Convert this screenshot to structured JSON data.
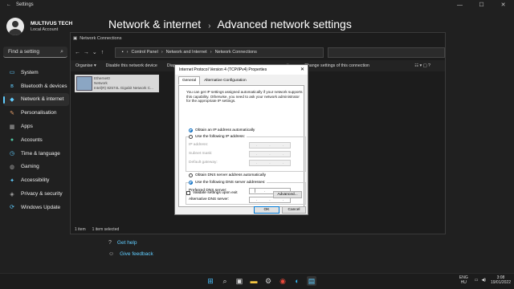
{
  "settings": {
    "title": "Settings",
    "window_controls": {
      "minimize": "—",
      "maximize": "☐",
      "close": "✕"
    },
    "profile": {
      "name": "MULTIVUS TECH",
      "subtitle": "Local Account"
    },
    "search": {
      "placeholder": "Find a setting",
      "icon": "search-icon"
    },
    "nav": [
      {
        "label": "System",
        "icon": "monitor-icon",
        "glyph": "▭",
        "color": "#60cdff"
      },
      {
        "label": "Bluetooth & devices",
        "icon": "bluetooth-icon",
        "glyph": "ʙ",
        "color": "#60cdff"
      },
      {
        "label": "Network & internet",
        "icon": "wifi-icon",
        "glyph": "◆",
        "color": "#60cdff",
        "active": true
      },
      {
        "label": "Personalisation",
        "icon": "brush-icon",
        "glyph": "✎",
        "color": "#e8a16c"
      },
      {
        "label": "Apps",
        "icon": "apps-icon",
        "glyph": "▦",
        "color": "#a6a6a6"
      },
      {
        "label": "Accounts",
        "icon": "person-icon",
        "glyph": "●",
        "color": "#4fc3a1"
      },
      {
        "label": "Time & language",
        "icon": "clock-icon",
        "glyph": "◷",
        "color": "#60cdff"
      },
      {
        "label": "Gaming",
        "icon": "gamepad-icon",
        "glyph": "◍",
        "color": "#a6a6a6"
      },
      {
        "label": "Accessibility",
        "icon": "accessibility-icon",
        "glyph": "✦",
        "color": "#60cdff"
      },
      {
        "label": "Privacy & security",
        "icon": "shield-icon",
        "glyph": "◈",
        "color": "#a6a6a6"
      },
      {
        "label": "Windows Update",
        "icon": "update-icon",
        "glyph": "⟳",
        "color": "#60cdff"
      }
    ],
    "breadcrumb": {
      "parent": "Network & internet",
      "separator": "›",
      "current": "Advanced network settings"
    },
    "help_links": [
      {
        "label": "Get help",
        "icon": "help-icon"
      },
      {
        "label": "Give feedback",
        "icon": "feedback-icon"
      }
    ]
  },
  "network_connections": {
    "title": "Network Connections",
    "address": [
      "Control Panel",
      "Network and Internet",
      "Network Connections"
    ],
    "toolbar": [
      "Organise ▾",
      "Disable this network device",
      "Diagno"
    ],
    "toolbar_right": [
      "nection",
      "Change settings of this connection"
    ],
    "adapter": {
      "name": "Ethernet0",
      "status": "Network",
      "device": "Intel(R) 82574L Gigabit Network C..."
    },
    "status_bar": {
      "count": "1 item",
      "selected": "1 item selected"
    }
  },
  "ipv4_dialog": {
    "title": "Internet Protocol Version 4 (TCP/IPv4) Properties",
    "tabs": [
      "General",
      "Alternative Configuration"
    ],
    "description": "You can get IP settings assigned automatically if your network supports this capability. Otherwise, you need to ask your network administrator for the appropriate IP settings.",
    "obtain_ip_auto": "Obtain an IP address automatically",
    "use_ip": "Use the following IP address:",
    "ip_fields": [
      "IP address:",
      "Subnet mask:",
      "Default gateway:"
    ],
    "obtain_dns_auto": "Obtain DNS server address automatically",
    "use_dns": "Use the following DNS server addresses:",
    "dns_fields": [
      "Preferred DNS server:",
      "Alternative DNS server:"
    ],
    "validate": "Validate settings upon exit",
    "advanced_button": "Advanced...",
    "ok_button": "OK",
    "cancel_button": "Cancel"
  },
  "taskbar": {
    "apps": [
      "start-icon",
      "search-icon",
      "task-view-icon",
      "file-explorer-icon",
      "settings-icon",
      "chrome-icon",
      "edge-icon",
      "network-app-icon"
    ],
    "language": [
      "ENG",
      "HU"
    ],
    "time": "3:08",
    "date": "19/01/2022"
  },
  "colors": {
    "accent": "#60cdff",
    "background": "#202020"
  }
}
